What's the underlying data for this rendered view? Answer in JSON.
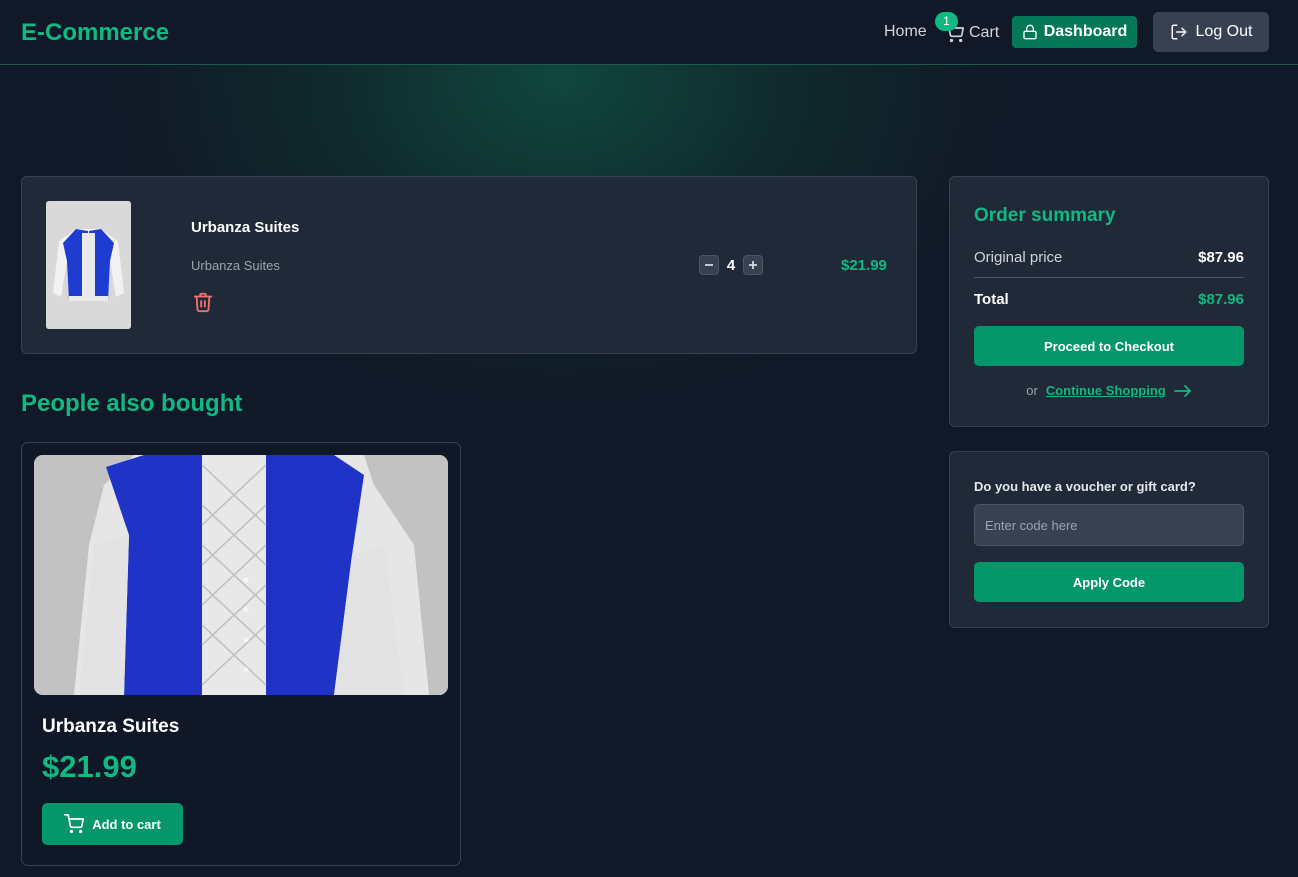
{
  "header": {
    "logo": "E-Commerce",
    "nav_home": "Home",
    "nav_cart": "Cart",
    "cart_count": "1",
    "dashboard_label": "Dashboard",
    "logout_label": "Log Out"
  },
  "cart": {
    "items": [
      {
        "name": "Urbanza Suites",
        "description": "Urbanza Suites",
        "quantity": "4",
        "price": "$21.99",
        "image_icon": "varsity-jacket-image"
      }
    ]
  },
  "recommendations": {
    "title": "People also bought",
    "items": [
      {
        "name": "Urbanza Suites",
        "price": "$21.99",
        "add_label": "Add to cart",
        "image_icon": "varsity-jacket-image"
      }
    ]
  },
  "summary": {
    "title": "Order summary",
    "original_price_label": "Original price",
    "original_price_value": "$87.96",
    "total_label": "Total",
    "total_value": "$87.96",
    "checkout_label": "Proceed to Checkout",
    "or_label": "or",
    "continue_label": "Continue Shopping"
  },
  "voucher": {
    "label": "Do you have a voucher or gift card?",
    "placeholder": "Enter code here",
    "apply_label": "Apply Code"
  },
  "colors": {
    "accent": "#10b981",
    "button": "#059669",
    "card": "#1f2937",
    "background": "#111827",
    "danger": "#f87171"
  }
}
